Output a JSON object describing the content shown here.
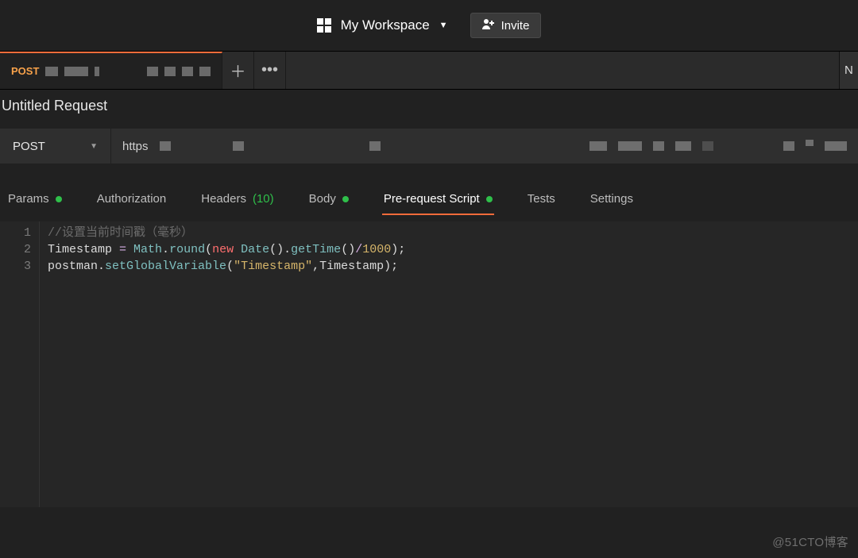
{
  "topbar": {
    "workspace_label": "My Workspace",
    "invite_label": "Invite"
  },
  "tabs": {
    "active": {
      "method": "POST"
    },
    "plus": "＋",
    "more": "•••",
    "right_panel_hint": "N"
  },
  "request": {
    "title": "Untitled Request",
    "method": "POST",
    "url_prefix": "https"
  },
  "subtabs": {
    "params": "Params",
    "authorization": "Authorization",
    "headers": "Headers",
    "headers_count": "(10)",
    "body": "Body",
    "prerequest": "Pre-request Script",
    "tests": "Tests",
    "settings": "Settings"
  },
  "editor": {
    "lines": [
      "1",
      "2",
      "3"
    ],
    "line1_comment": "//设置当前时间戳（毫秒）",
    "line2": {
      "ident": "Timestamp",
      "eq": " = ",
      "math": "Math",
      "dot1": ".",
      "round": "round",
      "open": "(",
      "new": "new",
      "space": " ",
      "date": "Date",
      "parens": "()",
      "dot2": ".",
      "gettime": "getTime",
      "parens2": "()",
      "slash": "/",
      "thousand": "1000",
      "close": ");"
    },
    "line3": {
      "postman": "postman",
      "dot": ".",
      "setgv": "setGlobalVariable",
      "open": "(",
      "str": "\"Timestamp\"",
      "comma": ",",
      "arg": "Timestamp",
      "close": ");"
    }
  },
  "watermark": "@51CTO博客"
}
